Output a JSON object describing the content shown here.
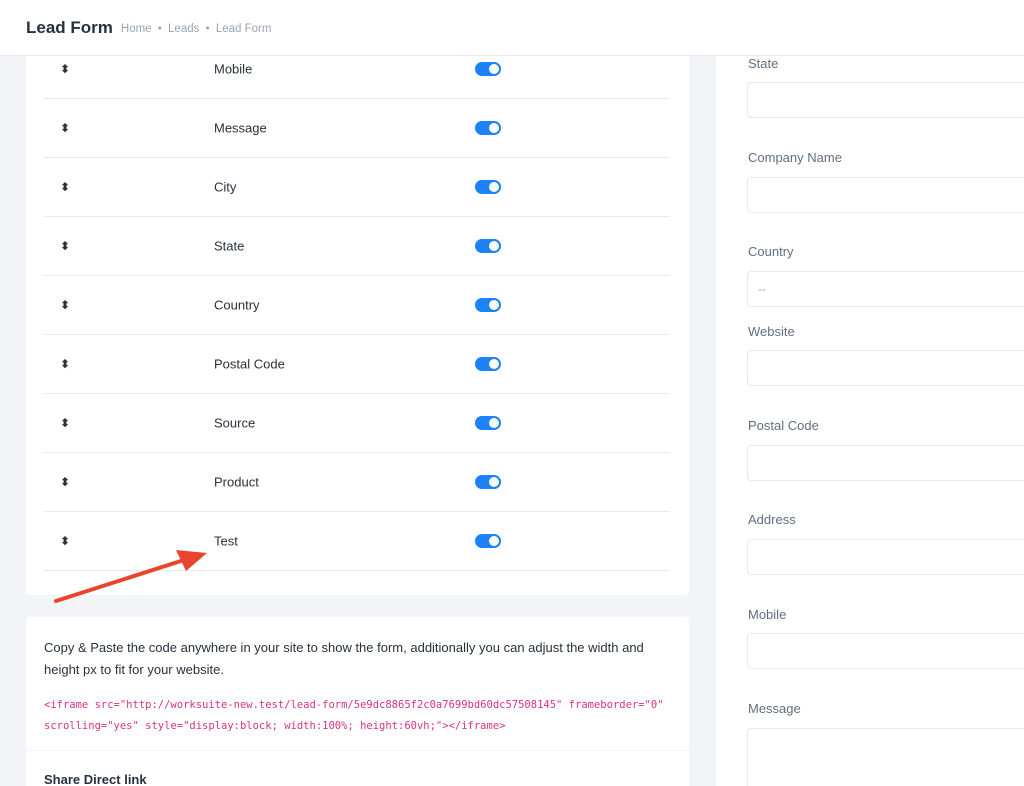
{
  "header": {
    "title": "Lead Form",
    "breadcrumb": [
      "Home",
      "Leads",
      "Lead Form"
    ],
    "separator": "•"
  },
  "fields": [
    {
      "label": "Mobile",
      "enabled": true
    },
    {
      "label": "Message",
      "enabled": true
    },
    {
      "label": "City",
      "enabled": true
    },
    {
      "label": "State",
      "enabled": true
    },
    {
      "label": "Country",
      "enabled": true
    },
    {
      "label": "Postal Code",
      "enabled": true
    },
    {
      "label": "Source",
      "enabled": true
    },
    {
      "label": "Product",
      "enabled": true
    },
    {
      "label": "Test",
      "enabled": true
    }
  ],
  "drag_glyph": "⬍",
  "embed": {
    "description": "Copy & Paste the code anywhere in your site to show the form, additionally you can adjust the width and height px to fit for your website.",
    "code": "<iframe src=\"http://worksuite-new.test/lead-form/5e9dc8865f2c0a7699bd60dc57508145\" frameborder=\"0\" scrolling=\"yes\" style=\"display:block; width:100%; height:60vh;\"></iframe>"
  },
  "share": {
    "title": "Share Direct link"
  },
  "preview": {
    "fields": [
      {
        "label": "State",
        "value": ""
      },
      {
        "label": "Company Name",
        "value": ""
      },
      {
        "label": "Country",
        "value": "--"
      },
      {
        "label": "Website",
        "value": ""
      },
      {
        "label": "Postal Code",
        "value": ""
      },
      {
        "label": "Address",
        "value": ""
      },
      {
        "label": "Mobile",
        "value": ""
      },
      {
        "label": "Message",
        "value": ""
      }
    ]
  },
  "colors": {
    "toggle_on": "#1d82f5",
    "code": "#d63384",
    "annotation_arrow": "#e8452c"
  }
}
